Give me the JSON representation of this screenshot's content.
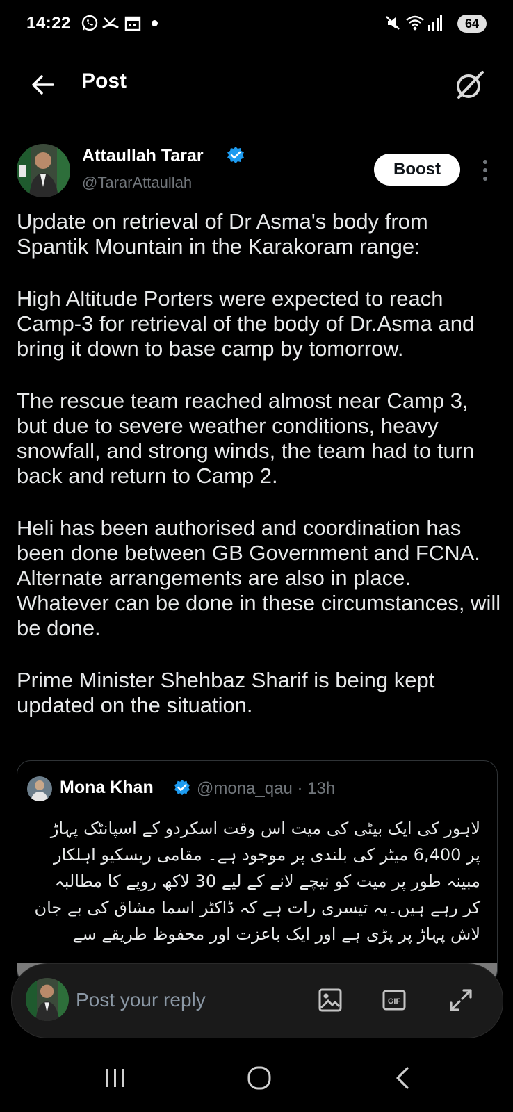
{
  "status_bar": {
    "time": "14:22",
    "left_icons": [
      "whatsapp-icon",
      "missed-call-icon",
      "calendar-icon",
      "dot-icon"
    ],
    "right_icons": [
      "mute-icon",
      "wifi-icon",
      "signal-icon"
    ],
    "battery": "64"
  },
  "header": {
    "title": "Post",
    "icons": [
      "back-arrow-icon",
      "grok-icon"
    ]
  },
  "post": {
    "author_name": "Attaullah Tarar",
    "author_handle": "@TararAttaullah",
    "boost_label": "Boost",
    "paragraphs": [
      "Update on retrieval of Dr Asma's body from Spantik Mountain in the Karakoram range:",
      "High Altitude Porters were expected to reach Camp-3 for retrieval of the body of Dr.Asma and bring it down to base camp by tomorrow.",
      "The rescue team reached almost near Camp 3, but due to severe weather conditions, heavy snowfall, and strong winds, the team had to turn back and return to Camp 2.",
      "Heli has been authorised and coordination has been done between GB Government and FCNA. Alternate arrangements are also in place. Whatever can be done in these circumstances, will be done.",
      "Prime Minister Shehbaz Sharif is being kept updated on the situation."
    ]
  },
  "quote": {
    "name": "Mona Khan",
    "handle": "@mona_qau",
    "separator": "·",
    "time": "13h",
    "text": "لاہور کی ایک بیٹی کی میت اس وقت اسکردو کے اسپانٹک پہاڑ پر 6,400 میٹر کی بلندی پر موجود ہے۔ مقامی ریسکیو اہلکار مبینہ طور پر میت کو نیچے لانے کے لیے 30 لاکھ روپے کا مطالبہ کر رہے ہیں۔یہ تیسری رات ہے کہ ڈاکٹر اسما مشاق کی بے جان لاش پہاڑ پر پڑی ہے اور ایک باعزت اور محفوظ طریقے سے"
  },
  "reply_bar": {
    "placeholder": "Post your reply",
    "gif_label": "GIF",
    "icons": [
      "image-icon",
      "gif-icon",
      "expand-icon"
    ]
  },
  "nav_bar": {
    "icons": [
      "recents-icon",
      "home-icon",
      "back-icon"
    ]
  },
  "colors": {
    "background": "#000000",
    "text": "#e7e9ea",
    "secondary_text": "#71767b",
    "verified_blue": "#1d9bf0"
  }
}
